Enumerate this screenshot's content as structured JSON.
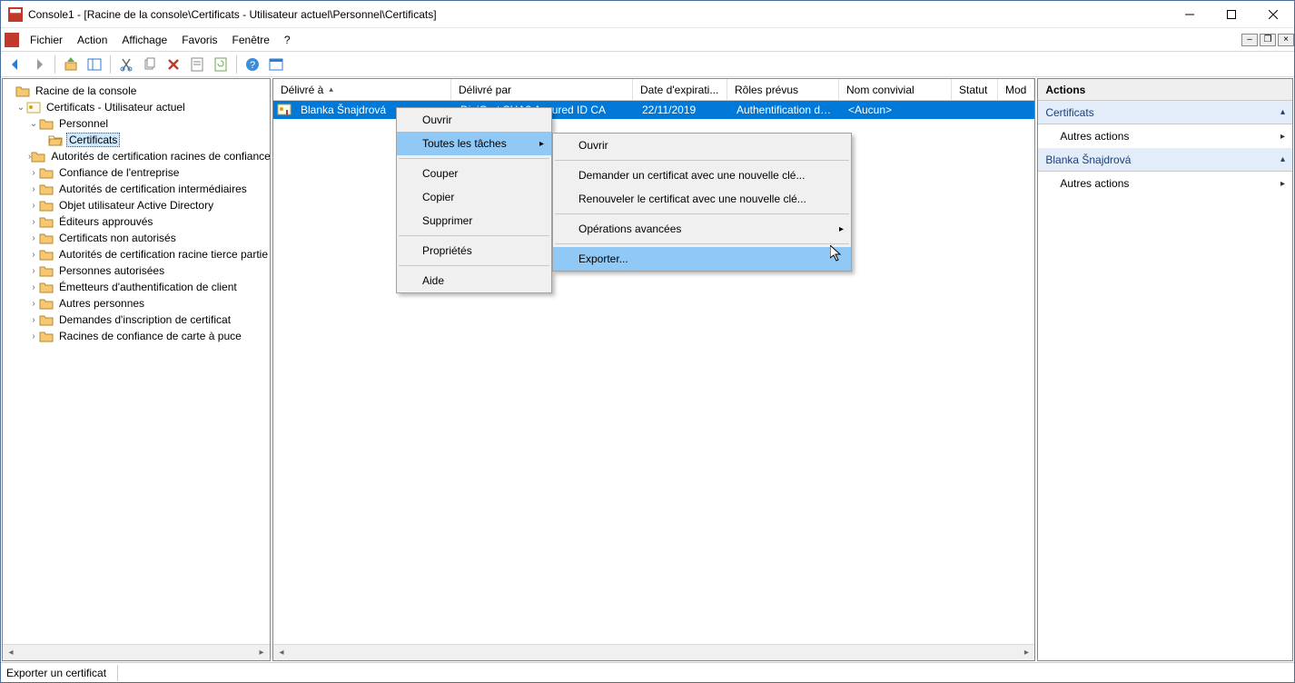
{
  "title": "Console1 - [Racine de la console\\Certificats - Utilisateur actuel\\Personnel\\Certificats]",
  "menu": {
    "fichier": "Fichier",
    "action": "Action",
    "affichage": "Affichage",
    "favoris": "Favoris",
    "fenetre": "Fenêtre",
    "aide": "?"
  },
  "tree": {
    "root": "Racine de la console",
    "certs_user": "Certificats - Utilisateur actuel",
    "personnel": "Personnel",
    "certificats": "Certificats",
    "items": [
      "Autorités de certification racines de confiance",
      "Confiance de l'entreprise",
      "Autorités de certification intermédiaires",
      "Objet utilisateur Active Directory",
      "Éditeurs approuvés",
      "Certificats non autorisés",
      "Autorités de certification racine tierce partie",
      "Personnes autorisées",
      "Émetteurs d'authentification de client",
      "Autres personnes",
      "Demandes d'inscription de certificat",
      "Racines de confiance de carte à puce"
    ]
  },
  "columns": {
    "delivre_a": "Délivré à",
    "delivre_par": "Délivré par",
    "expiration": "Date d'expirati...",
    "roles": "Rôles prévus",
    "nom": "Nom convivial",
    "statut": "Statut",
    "modele": "Mod"
  },
  "row": {
    "delivre_a": "Blanka Šnajdrová",
    "delivre_par": "DigiCert SHA2 Assured ID CA",
    "expiration": "22/11/2019",
    "roles": "Authentification du...",
    "nom": "<Aucun>"
  },
  "ctx1": {
    "ouvrir": "Ouvrir",
    "toutes": "Toutes les tâches",
    "couper": "Couper",
    "copier": "Copier",
    "supprimer": "Supprimer",
    "proprietes": "Propriétés",
    "aide": "Aide"
  },
  "ctx2": {
    "ouvrir": "Ouvrir",
    "demander": "Demander un certificat avec une nouvelle clé...",
    "renouveler": "Renouveler le certificat avec une nouvelle clé...",
    "avancees": "Opérations avancées",
    "exporter": "Exporter..."
  },
  "actions": {
    "title": "Actions",
    "section1": "Certificats",
    "item1": "Autres actions",
    "section2": "Blanka Šnajdrová",
    "item2": "Autres actions"
  },
  "status": "Exporter un certificat"
}
